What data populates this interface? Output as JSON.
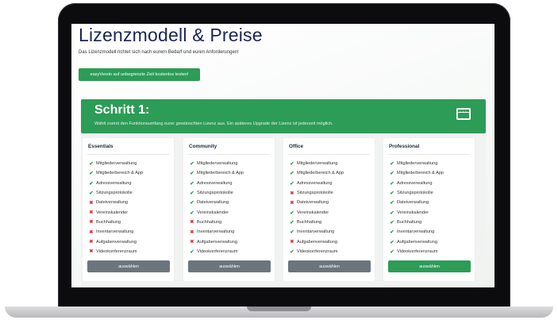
{
  "header": {
    "title": "Lizenzmodell & Preise",
    "subtitle": "Das Lizenzmodell richtet sich nach eurem Bedarf und euren Anforderungen!",
    "trial_button": "easyVerein auf unbegrenzte Zeit kostenlos testen!"
  },
  "step": {
    "title": "Schritt 1:",
    "description": "Wählt zuerst den Funktionsumfang eurer gewünschten Lizenz aus. Ein späteres Upgrade der Lizenz ist jederzeit möglich.",
    "icon": "browser-window-icon"
  },
  "colors": {
    "accent": "#2c9c57",
    "title": "#1b2553",
    "muted_button": "#6c757d",
    "check": "#2c9c57",
    "cross": "#d9303a"
  },
  "plans": [
    {
      "name": "Essentials",
      "button": "auswählen",
      "highlighted": false,
      "features": [
        {
          "label": "Mitgliederverwaltung",
          "included": true
        },
        {
          "label": "Mitgliederbereich & App",
          "included": true
        },
        {
          "label": "Adressverwaltung",
          "included": true
        },
        {
          "label": "Sitzungsprotokolle",
          "included": true
        },
        {
          "label": "Dateiverwaltung",
          "included": false
        },
        {
          "label": "Vereinskalender",
          "included": false
        },
        {
          "label": "Buchhaltung",
          "included": false
        },
        {
          "label": "Inventarverwaltung",
          "included": false
        },
        {
          "label": "Aufgabenverwaltung",
          "included": false
        },
        {
          "label": "Videokonferenzraum",
          "included": false
        }
      ]
    },
    {
      "name": "Community",
      "button": "auswählen",
      "highlighted": false,
      "features": [
        {
          "label": "Mitgliederverwaltung",
          "included": true
        },
        {
          "label": "Mitgliederbereich & App",
          "included": true
        },
        {
          "label": "Adressverwaltung",
          "included": true
        },
        {
          "label": "Sitzungsprotokolle",
          "included": true
        },
        {
          "label": "Dateiverwaltung",
          "included": true
        },
        {
          "label": "Vereinskalender",
          "included": true
        },
        {
          "label": "Buchhaltung",
          "included": false
        },
        {
          "label": "Inventarverwaltung",
          "included": false
        },
        {
          "label": "Aufgabenverwaltung",
          "included": false
        },
        {
          "label": "Videokonferenzraum",
          "included": true
        }
      ]
    },
    {
      "name": "Office",
      "button": "auswählen",
      "highlighted": false,
      "features": [
        {
          "label": "Mitgliederverwaltung",
          "included": true
        },
        {
          "label": "Mitgliederbereich & App",
          "included": true
        },
        {
          "label": "Adressverwaltung",
          "included": true
        },
        {
          "label": "Sitzungsprotokolle",
          "included": false
        },
        {
          "label": "Dateiverwaltung",
          "included": false
        },
        {
          "label": "Vereinskalender",
          "included": true
        },
        {
          "label": "Buchhaltung",
          "included": true
        },
        {
          "label": "Inventarverwaltung",
          "included": true
        },
        {
          "label": "Aufgabenverwaltung",
          "included": false
        },
        {
          "label": "Videokonferenzraum",
          "included": true
        }
      ]
    },
    {
      "name": "Professional",
      "button": "auswählen",
      "highlighted": true,
      "features": [
        {
          "label": "Mitgliederverwaltung",
          "included": true
        },
        {
          "label": "Mitgliederbereich & App",
          "included": true
        },
        {
          "label": "Adressverwaltung",
          "included": true
        },
        {
          "label": "Sitzungsprotokolle",
          "included": true
        },
        {
          "label": "Dateiverwaltung",
          "included": true
        },
        {
          "label": "Vereinskalender",
          "included": true
        },
        {
          "label": "Buchhaltung",
          "included": true
        },
        {
          "label": "Inventarverwaltung",
          "included": true
        },
        {
          "label": "Aufgabenverwaltung",
          "included": true
        },
        {
          "label": "Videokonferenzraum",
          "included": true
        }
      ]
    }
  ]
}
